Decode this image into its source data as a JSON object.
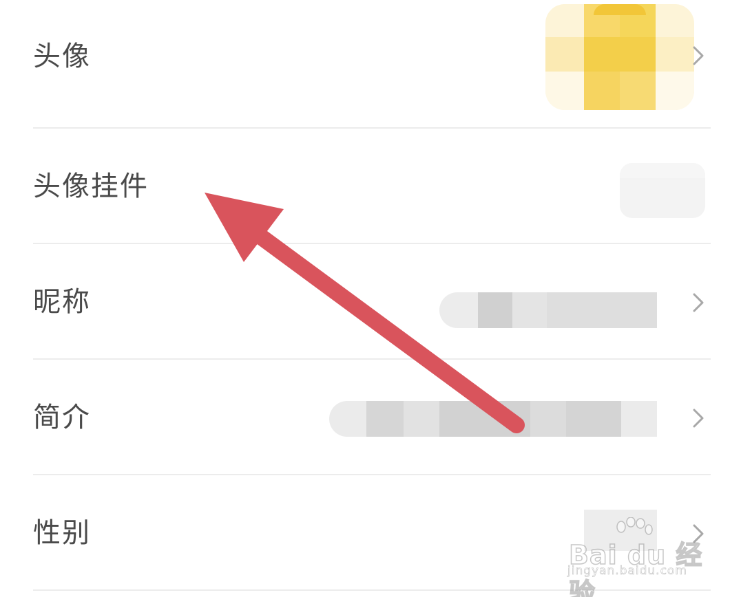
{
  "rows": [
    {
      "label": "头像"
    },
    {
      "label": "头像挂件"
    },
    {
      "label": "昵称"
    },
    {
      "label": "简介"
    },
    {
      "label": "性别"
    }
  ],
  "watermark": {
    "brand": "Bai du 经验",
    "url": "jingyan.baidu.com"
  },
  "colors": {
    "arrow": "#d9545c",
    "label": "#4a4a4a",
    "divider": "#ececec",
    "avatar": "#f7d04a"
  },
  "icons": {
    "chevron": "chevron-right-icon",
    "watermark": "paw-icon"
  }
}
